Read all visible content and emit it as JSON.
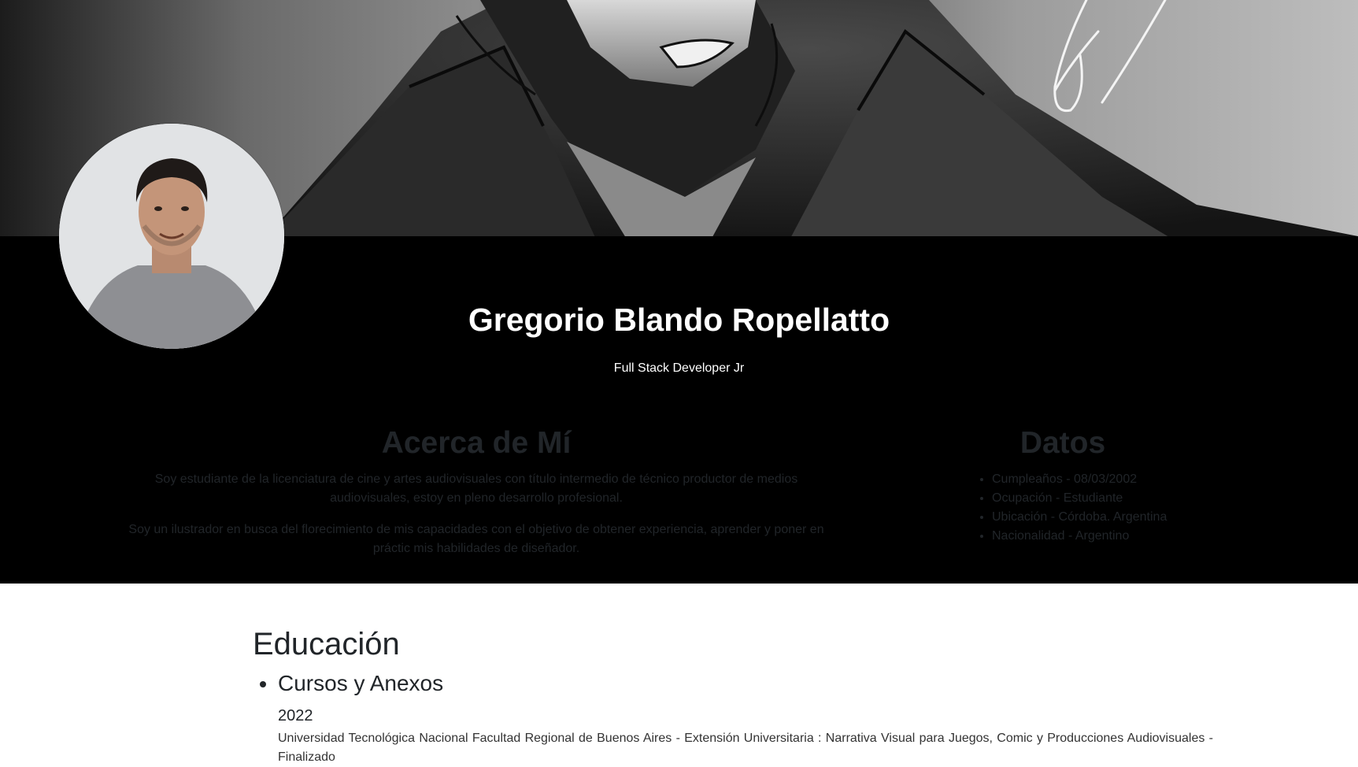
{
  "profile": {
    "name": "Gregorio Blando Ropellatto",
    "role": "Full Stack Developer Jr"
  },
  "about": {
    "title": "Acerca de Mí",
    "paragraphs": [
      "Soy estudiante de la licenciatura de cine y artes audiovisuales con título intermedio de técnico productor de medios audiovisuales, estoy en pleno desarrollo profesional.",
      "Soy un ilustrador en busca del florecimiento de mis capacidades con el objetivo de obtener experiencia, aprender y poner en práctic mis habilidades de diseñador."
    ]
  },
  "datos": {
    "title": "Datos",
    "items": [
      "Cumpleaños - 08/03/2002",
      "Ocupación - Estudiante",
      "Ubicación - Córdoba. Argentina",
      "Nacionalidad - Argentino"
    ]
  },
  "education": {
    "title": "Educación",
    "categories": [
      {
        "title": "Cursos y Anexos",
        "entries": [
          {
            "year": "2022",
            "description": "Universidad Tecnológica Nacional Facultad Regional de Buenos Aires - Extensión Universitaria : Narrativa Visual para Juegos, Comic y Producciones Audiovisuales - Finalizado"
          }
        ]
      }
    ]
  },
  "colors": {
    "dark_section": "#000000",
    "text_light": "#ffffff",
    "text_dark": "#212529"
  },
  "icons": [
    "banner-illustration",
    "profile-photo",
    "signature-mark"
  ]
}
